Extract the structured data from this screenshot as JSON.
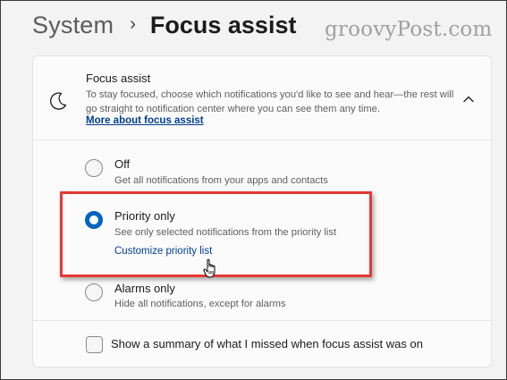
{
  "breadcrumb": {
    "parent": "System",
    "separator": "›",
    "current": "Focus assist"
  },
  "watermark": "groovyPost.com",
  "focus_assist": {
    "icon": "moon-icon",
    "title": "Focus assist",
    "description": "To stay focused, choose which notifications you'd like to see and hear—the rest will go straight to notification center where you can see them any time.",
    "link": "More about focus assist",
    "expanded": true
  },
  "options": [
    {
      "label": "Off",
      "description": "Get all notifications from your apps and contacts",
      "selected": false
    },
    {
      "label": "Priority only",
      "description": "See only selected notifications from the priority list",
      "link": "Customize priority list",
      "selected": true
    },
    {
      "label": "Alarms only",
      "description": "Hide all notifications, except for alarms",
      "selected": false
    }
  ],
  "summary": {
    "label": "Show a summary of what I missed when focus assist was on",
    "checked": false
  },
  "colors": {
    "accent": "#0067c0",
    "link": "#003e92",
    "highlight": "#e53935"
  }
}
